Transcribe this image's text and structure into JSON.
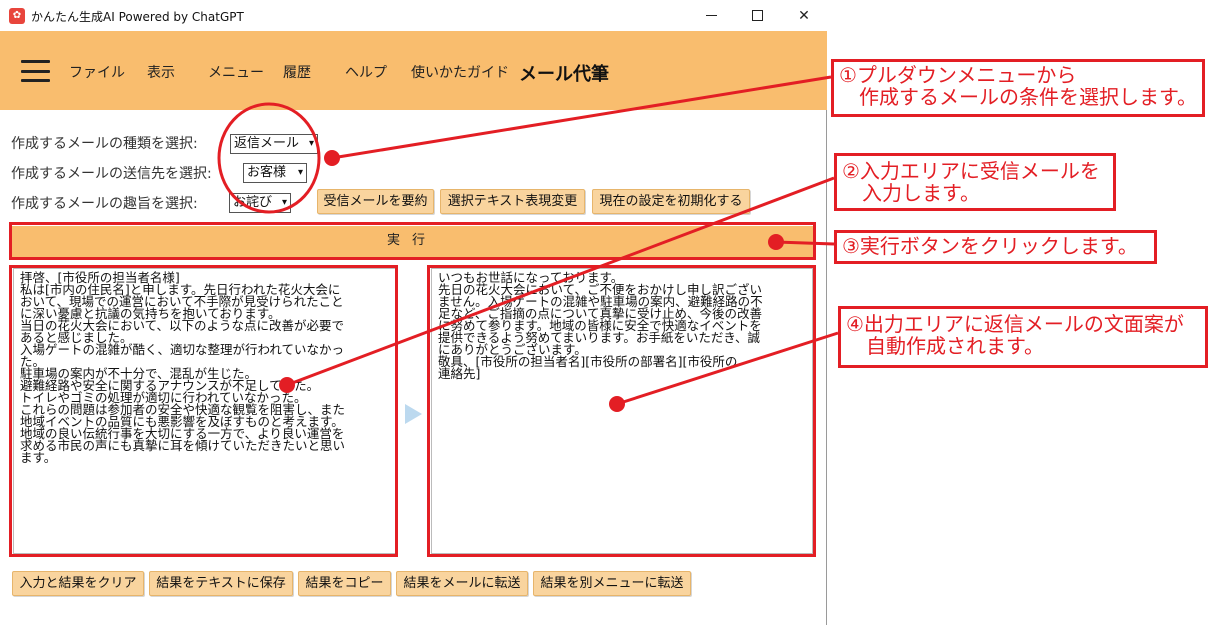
{
  "window": {
    "icon_glyph": "✿",
    "title": "かんたん生成AI Powered by ChatGPT",
    "controls": {
      "minimize": "",
      "maximize": "",
      "close": "✕"
    }
  },
  "menu": {
    "items": [
      "ファイル",
      "表示",
      "メニュー",
      "履歴",
      "ヘルプ",
      "使いかたガイド"
    ],
    "current": "メール代筆"
  },
  "form": {
    "type_label": "作成するメールの種類を選択:",
    "type_value": "返信メール",
    "dest_label": "作成するメールの送信先を選択:",
    "dest_value": "お客様",
    "intent_label": "作成するメールの趣旨を選択:",
    "intent_value": "お詫び",
    "buttons": [
      "受信メールを要約",
      "選択テキスト表現変更",
      "現在の設定を初期化する"
    ]
  },
  "run_label": "実行",
  "input_text": "拝啓、[市役所の担当者名様]\n私は[市内の住民名]と申します。先日行われた花火大会に\nおいて、現場での運営において不手際が見受けられたこと\nに深い憂慮と抗議の気持ちを抱いております。\n当日の花火大会において、以下のような点に改善が必要で\nあると感じました。\n入場ゲートの混雑が酷く、適切な整理が行われていなかっ\nた。\n駐車場の案内が不十分で、混乱が生じた。\n避難経路や安全に関するアナウンスが不足していた。\nトイレやゴミの処理が適切に行われていなかった。\nこれらの問題は参加者の安全や快適な観覧を阻害し、また\n地域イベントの品質にも悪影響を及ぼすものと考えます。\n地域の良い伝統行事を大切にする一方で、より良い運営を\n求める市民の声にも真摯に耳を傾けていただきたいと思い\nます。",
  "output_text": "いつもお世話になっております。\n先日の花火大会において、ご不便をおかけし申し訳ござい\nません。入場ゲートの混雑や駐車場の案内、避難経路の不\n足など、ご指摘の点について真摯に受け止め、今後の改善\nに努めて参ります。地域の皆様に安全で快適なイベントを\n提供できるよう努めてまいります。お手紙をいただき、誠\nにありがとうございます。\n敬具、[市役所の担当者名][市役所の部署名][市役所の\n連絡先]",
  "bottom_buttons": [
    "入力と結果をクリア",
    "結果をテキストに保存",
    "結果をコピー",
    "結果をメールに転送",
    "結果を別メニューに転送"
  ],
  "annotations": [
    "①プルダウンメニューから\n　作成するメールの条件を選択します。",
    "②入力エリアに受信メールを\n　入力します。",
    "③実行ボタンをクリックします。",
    "④出力エリアに返信メールの文面案が\n　自動作成されます。"
  ],
  "colors": {
    "menubar": "#f9bd6e",
    "button": "#f9d49e",
    "annotation": "#e31e24"
  }
}
